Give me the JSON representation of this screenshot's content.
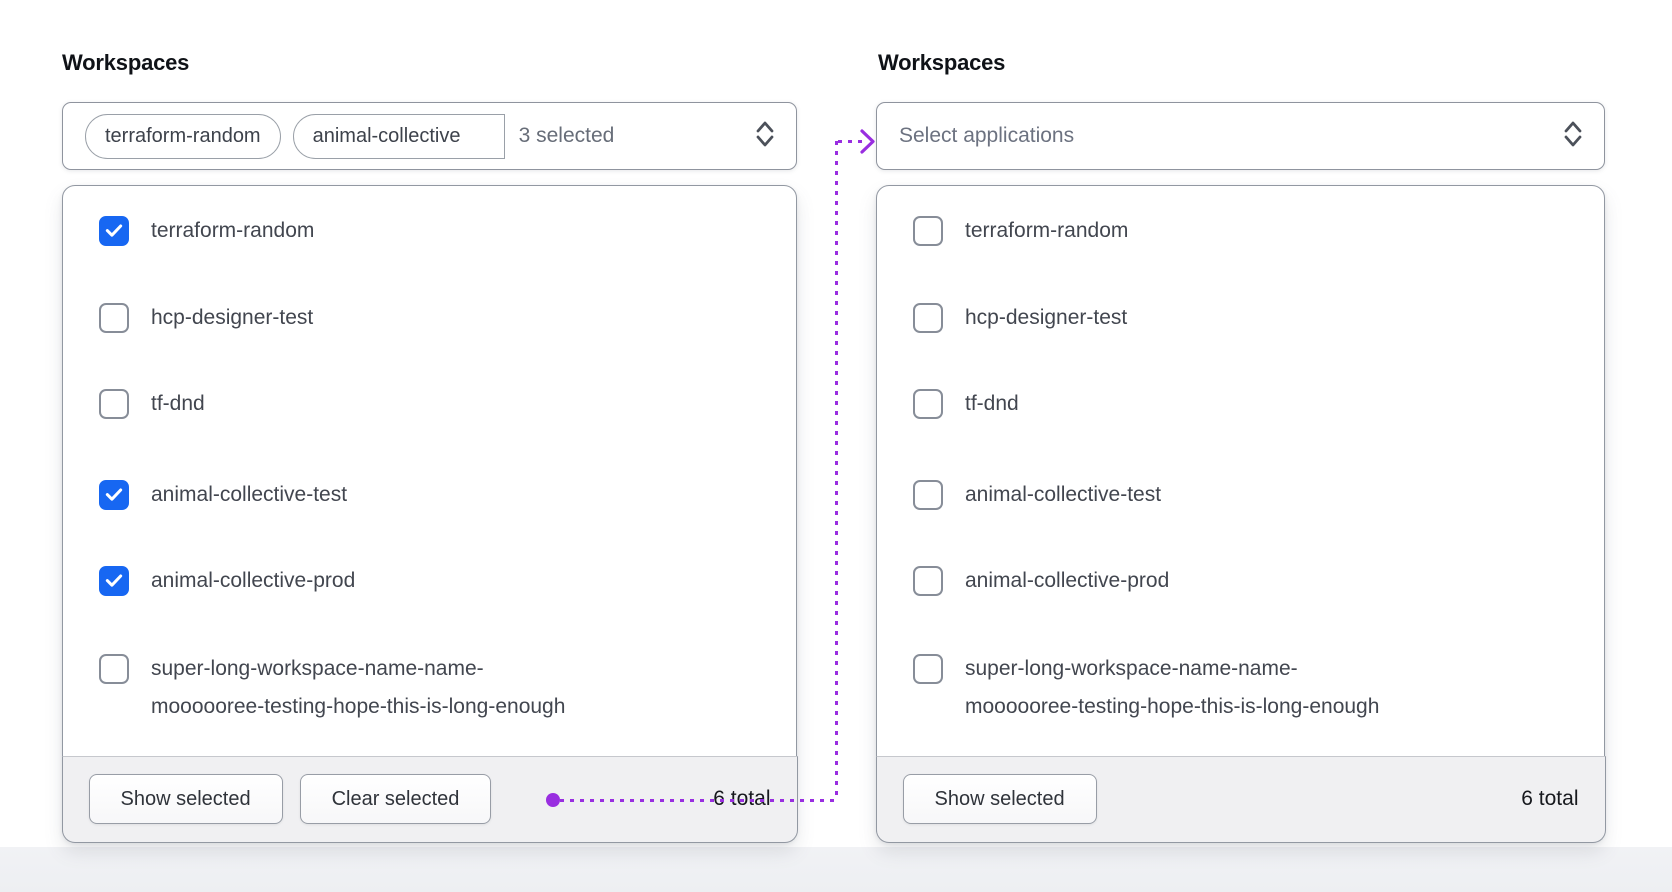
{
  "colors": {
    "checkbox_selected_blue": "#1767f2",
    "connector_purple": "#992ee0",
    "footer_background": "#f0f0f2"
  },
  "left": {
    "label": "Workspaces",
    "trigger": {
      "chips": [
        "terraform-random",
        "animal-collective"
      ],
      "count_text": "3 selected",
      "chevron_icon": "chevron-up-down-icon"
    },
    "items": [
      {
        "label": "terraform-random",
        "checked": true
      },
      {
        "label": "hcp-designer-test",
        "checked": false
      },
      {
        "label": "tf-dnd",
        "checked": false
      },
      {
        "label": "animal-collective-test",
        "checked": true
      },
      {
        "label": "animal-collective-prod",
        "checked": true
      },
      {
        "label": "super-long-workspace-name-name-",
        "label2": "moooooree-testing-hope-this-is-long-enough",
        "checked": false
      }
    ],
    "footer": {
      "show_selected": "Show selected",
      "clear_selected": "Clear selected",
      "total": "6 total"
    }
  },
  "right": {
    "label": "Workspaces",
    "trigger": {
      "placeholder": "Select applications",
      "chevron_icon": "chevron-up-down-icon"
    },
    "items": [
      {
        "label": "terraform-random",
        "checked": false
      },
      {
        "label": "hcp-designer-test",
        "checked": false
      },
      {
        "label": "tf-dnd",
        "checked": false
      },
      {
        "label": "animal-collective-test",
        "checked": false
      },
      {
        "label": "animal-collective-prod",
        "checked": false
      },
      {
        "label": "super-long-workspace-name-name-",
        "label2": "moooooree-testing-hope-this-is-long-enough",
        "checked": false
      }
    ],
    "footer": {
      "show_selected": "Show selected",
      "total": "6 total"
    }
  }
}
